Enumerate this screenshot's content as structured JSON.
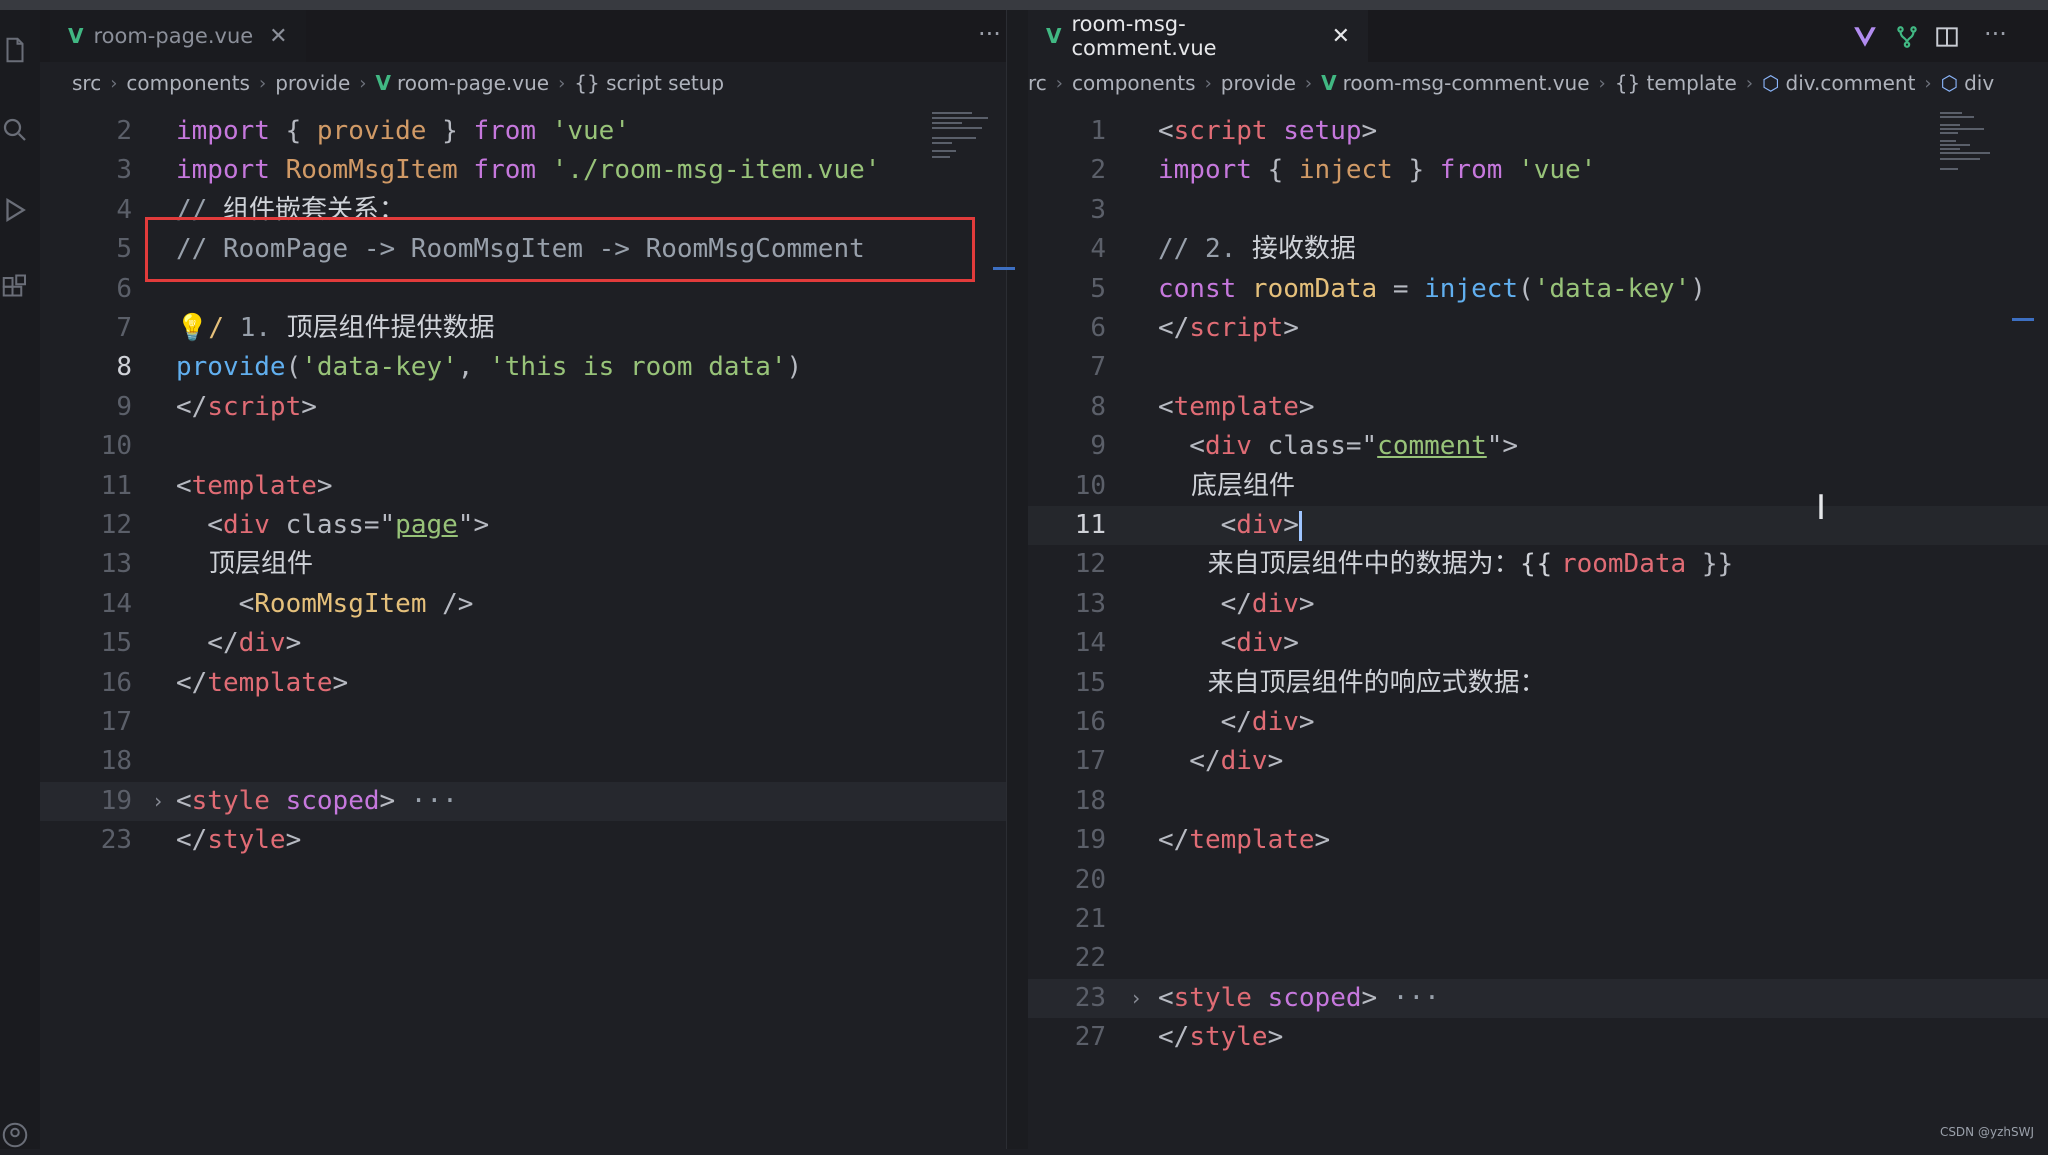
{
  "left": {
    "tab": {
      "name": "room-page.vue",
      "close": "✕",
      "more": "···"
    },
    "breadcrumb": [
      "src",
      "components",
      "provide",
      "room-page.vue",
      "{} script setup"
    ],
    "lines": [
      {
        "n": "2",
        "segs": [
          [
            "kw",
            "import "
          ],
          [
            "punc",
            "{ "
          ],
          [
            "prop",
            "provide"
          ],
          [
            "punc",
            " } "
          ],
          [
            "kw",
            "from "
          ],
          [
            "str",
            "'vue'"
          ]
        ]
      },
      {
        "n": "3",
        "segs": [
          [
            "kw",
            "import "
          ],
          [
            "prop",
            "RoomMsgItem "
          ],
          [
            "kw",
            "from "
          ],
          [
            "str",
            "'./room-msg-item.vue'"
          ]
        ]
      },
      {
        "n": "4",
        "segs": [
          [
            "cmt",
            "// "
          ],
          [
            "zh",
            "组件嵌套关系："
          ]
        ]
      },
      {
        "n": "5",
        "segs": [
          [
            "cmt",
            "// RoomPage -> RoomMsgItem -> RoomMsgComment"
          ]
        ]
      },
      {
        "n": "6",
        "segs": []
      },
      {
        "n": "7",
        "segs": [
          [
            "var",
            "💡/ "
          ],
          [
            "cmt",
            "1. "
          ],
          [
            "zh",
            "顶层组件提供数据"
          ]
        ]
      },
      {
        "n": "8",
        "segs": [
          [
            "fn",
            "provide"
          ],
          [
            "punc",
            "("
          ],
          [
            "str",
            "'data-key'"
          ],
          [
            "punc",
            ", "
          ],
          [
            "str",
            "'this is room data'"
          ],
          [
            "punc",
            ")"
          ]
        ]
      },
      {
        "n": "9",
        "segs": [
          [
            "punc",
            "</"
          ],
          [
            "tag",
            "script"
          ],
          [
            "punc",
            ">"
          ]
        ]
      },
      {
        "n": "10",
        "segs": []
      },
      {
        "n": "11",
        "segs": [
          [
            "punc",
            "<"
          ],
          [
            "tag",
            "template"
          ],
          [
            "punc",
            ">"
          ]
        ]
      },
      {
        "n": "12",
        "segs": [
          [
            "punc",
            "  <"
          ],
          [
            "tag",
            "div "
          ],
          [
            "punc",
            "class=\""
          ],
          [
            "str ul",
            "page"
          ],
          [
            "punc",
            "\">"
          ]
        ]
      },
      {
        "n": "13",
        "segs": [
          [
            "zh",
            "    顶层组件"
          ]
        ]
      },
      {
        "n": "14",
        "segs": [
          [
            "punc",
            "    <"
          ],
          [
            "var",
            "RoomMsgItem "
          ],
          [
            "punc",
            "/>"
          ]
        ]
      },
      {
        "n": "15",
        "segs": [
          [
            "punc",
            "  </"
          ],
          [
            "tag",
            "div"
          ],
          [
            "punc",
            ">"
          ]
        ]
      },
      {
        "n": "16",
        "segs": [
          [
            "punc",
            "</"
          ],
          [
            "tag",
            "template"
          ],
          [
            "punc",
            ">"
          ]
        ]
      },
      {
        "n": "17",
        "segs": []
      },
      {
        "n": "18",
        "segs": []
      },
      {
        "n": "19",
        "segs": [
          [
            "punc",
            "<"
          ],
          [
            "tag",
            "style "
          ],
          [
            "kw",
            "scoped"
          ],
          [
            "punc",
            ">"
          ],
          [
            "cmt",
            " ···"
          ]
        ]
      },
      {
        "n": "23",
        "segs": [
          [
            "punc",
            "</"
          ],
          [
            "tag",
            "style"
          ],
          [
            "punc",
            ">"
          ]
        ]
      }
    ]
  },
  "right": {
    "tab": {
      "name": "room-msg-comment.vue",
      "close": "✕",
      "more": "···"
    },
    "breadcrumb": [
      "rc",
      "components",
      "provide",
      "room-msg-comment.vue",
      "{} template",
      "div.comment",
      "div"
    ],
    "lines": [
      {
        "n": "1",
        "segs": [
          [
            "punc",
            "<"
          ],
          [
            "tag",
            "script "
          ],
          [
            "kw",
            "setup"
          ],
          [
            "punc",
            ">"
          ]
        ]
      },
      {
        "n": "2",
        "segs": [
          [
            "kw",
            "import "
          ],
          [
            "punc",
            "{ "
          ],
          [
            "prop",
            "inject"
          ],
          [
            "punc",
            " } "
          ],
          [
            "kw",
            "from "
          ],
          [
            "str",
            "'vue'"
          ]
        ]
      },
      {
        "n": "3",
        "segs": []
      },
      {
        "n": "4",
        "segs": [
          [
            "cmt",
            "// 2. "
          ],
          [
            "zh",
            "接收数据"
          ]
        ]
      },
      {
        "n": "5",
        "segs": [
          [
            "kw",
            "const "
          ],
          [
            "var",
            "roomData "
          ],
          [
            "punc",
            "= "
          ],
          [
            "fn",
            "inject"
          ],
          [
            "punc",
            "("
          ],
          [
            "str",
            "'data-key'"
          ],
          [
            "punc",
            ")"
          ]
        ]
      },
      {
        "n": "6",
        "segs": [
          [
            "punc",
            "</"
          ],
          [
            "tag",
            "script"
          ],
          [
            "punc",
            ">"
          ]
        ]
      },
      {
        "n": "7",
        "segs": []
      },
      {
        "n": "8",
        "segs": [
          [
            "punc",
            "<"
          ],
          [
            "tag",
            "template"
          ],
          [
            "punc",
            ">"
          ]
        ]
      },
      {
        "n": "9",
        "segs": [
          [
            "punc",
            "  <"
          ],
          [
            "tag",
            "div "
          ],
          [
            "punc",
            "class=\""
          ],
          [
            "str ul",
            "comment"
          ],
          [
            "punc",
            "\">"
          ]
        ]
      },
      {
        "n": "10",
        "segs": [
          [
            "zh",
            "    底层组件"
          ]
        ]
      },
      {
        "n": "11",
        "segs": [
          [
            "punc",
            "    <"
          ],
          [
            "tag",
            "div"
          ],
          [
            "punc",
            ">"
          ]
        ]
      },
      {
        "n": "12",
        "segs": [
          [
            "zh",
            "      来自顶层组件中的数据为：{{ "
          ],
          [
            "tag",
            "roomData"
          ],
          [
            "punc",
            " }}"
          ]
        ]
      },
      {
        "n": "13",
        "segs": [
          [
            "punc",
            "    </"
          ],
          [
            "tag",
            "div"
          ],
          [
            "punc",
            ">"
          ]
        ]
      },
      {
        "n": "14",
        "segs": [
          [
            "punc",
            "    <"
          ],
          [
            "tag",
            "div"
          ],
          [
            "punc",
            ">"
          ]
        ]
      },
      {
        "n": "15",
        "segs": [
          [
            "zh",
            "      来自顶层组件的响应式数据："
          ]
        ]
      },
      {
        "n": "16",
        "segs": [
          [
            "punc",
            "    </"
          ],
          [
            "tag",
            "div"
          ],
          [
            "punc",
            ">"
          ]
        ]
      },
      {
        "n": "17",
        "segs": [
          [
            "punc",
            "  </"
          ],
          [
            "tag",
            "div"
          ],
          [
            "punc",
            ">"
          ]
        ]
      },
      {
        "n": "18",
        "segs": []
      },
      {
        "n": "19",
        "segs": [
          [
            "punc",
            "</"
          ],
          [
            "tag",
            "template"
          ],
          [
            "punc",
            ">"
          ]
        ]
      },
      {
        "n": "20",
        "segs": []
      },
      {
        "n": "21",
        "segs": []
      },
      {
        "n": "22",
        "segs": []
      },
      {
        "n": "23",
        "segs": [
          [
            "punc",
            "<"
          ],
          [
            "tag",
            "style "
          ],
          [
            "kw",
            "scoped"
          ],
          [
            "punc",
            ">"
          ],
          [
            "cmt",
            " ···"
          ]
        ]
      },
      {
        "n": "27",
        "segs": [
          [
            "punc",
            "</"
          ],
          [
            "tag",
            "style"
          ],
          [
            "punc",
            ">"
          ]
        ]
      }
    ]
  },
  "watermark": "CSDN @yzhSWJ",
  "icons": {
    "activity": [
      "files-icon",
      "search-icon",
      "run-debug-icon",
      "extensions-icon",
      "account-icon"
    ],
    "right_toolbar": [
      "vue-devtools-icon",
      "source-control-icon",
      "split-editor-icon",
      "more-actions-icon"
    ]
  }
}
